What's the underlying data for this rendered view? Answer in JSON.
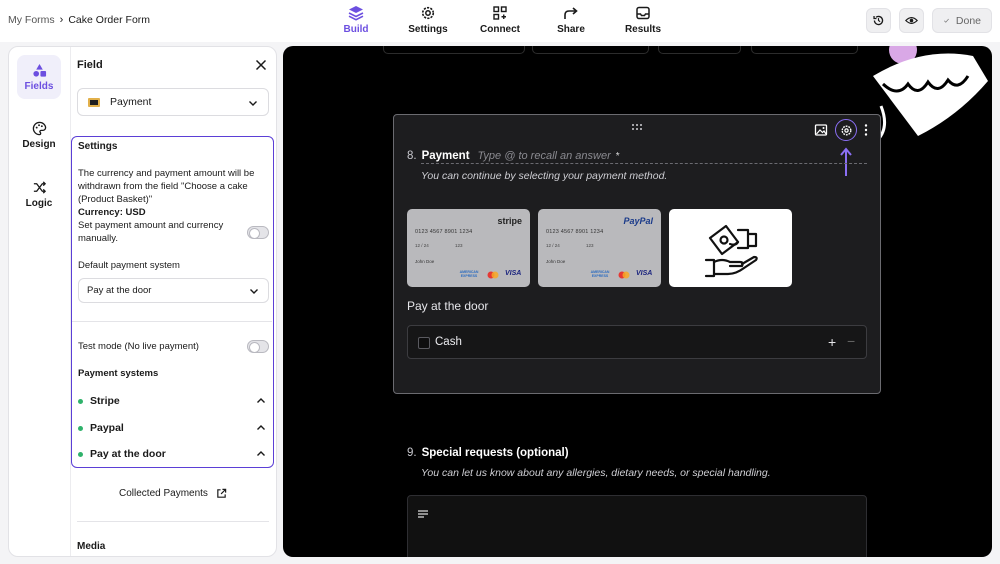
{
  "breadcrumb": {
    "parent": "My Forms",
    "separator": "›",
    "current": "Cake Order Form"
  },
  "nav": [
    {
      "label": "Build",
      "icon": "layers-icon",
      "active": true
    },
    {
      "label": "Settings",
      "icon": "gear-icon"
    },
    {
      "label": "Connect",
      "icon": "connect-icon"
    },
    {
      "label": "Share",
      "icon": "share-icon"
    },
    {
      "label": "Results",
      "icon": "inbox-icon"
    }
  ],
  "toolbar": {
    "done_label": "Done",
    "history_icon": "history-icon",
    "preview_icon": "eye-icon"
  },
  "rail": [
    {
      "label": "Fields",
      "icon": "shapes-icon",
      "active": true
    },
    {
      "label": "Design",
      "icon": "palette-icon"
    },
    {
      "label": "Logic",
      "icon": "shuffle-icon"
    }
  ],
  "field_panel": {
    "title": "Field",
    "field_type": "Payment",
    "settings_title": "Settings",
    "desc_line": "The currency and payment amount will be withdrawn from the field \"Choose a cake (Product Basket)\"",
    "currency": "Currency: USD",
    "manual_label": "Set payment amount and currency manually.",
    "manual_enabled": false,
    "default_system_label": "Default payment system",
    "default_system_value": "Pay at the door",
    "test_mode_label": "Test mode (No live payment)",
    "test_mode_enabled": false,
    "systems_title": "Payment systems",
    "systems": [
      {
        "name": "Stripe",
        "status_color": "#2fb26b"
      },
      {
        "name": "Paypal",
        "status_color": "#2fb26b"
      },
      {
        "name": "Pay at the door",
        "status_color": "#2fb26b"
      }
    ],
    "collected_label": "Collected Payments",
    "media_label": "Media"
  },
  "question8": {
    "number": "8.",
    "title": "Payment",
    "placeholder": "Type @ to recall an answer",
    "required_mark": "*",
    "description": "You can continue by selecting your payment method.",
    "cards": [
      {
        "brand": "stripe",
        "number": "0123 4567 8901 1234",
        "expiry": "12 / 24",
        "cvc": "123",
        "holder": "John Doe",
        "logos": [
          "AMERICAN EXPRESS",
          "mastercard",
          "VISA"
        ]
      },
      {
        "brand": "PayPal",
        "number": "0123 4567 8901 1234",
        "expiry": "12 / 24",
        "cvc": "123",
        "holder": "John Doe",
        "logos": [
          "AMERICAN EXPRESS",
          "mastercard",
          "VISA"
        ]
      },
      {
        "brand": "Pay at the door",
        "icon": "cash-hand-icon",
        "selected": true
      }
    ],
    "selected_method_title": "Pay at the door",
    "option_label": "Cash",
    "plus": "+",
    "minus": "−"
  },
  "question9": {
    "number": "9.",
    "title": "Special requests (optional)",
    "description": "You can let us know about any allergies, dietary needs, or special handling."
  },
  "colors": {
    "accent": "#6c4fe0",
    "canvas_bg": "#000000",
    "card_bg": "#1d1d1f",
    "status_green": "#2fb26b"
  }
}
